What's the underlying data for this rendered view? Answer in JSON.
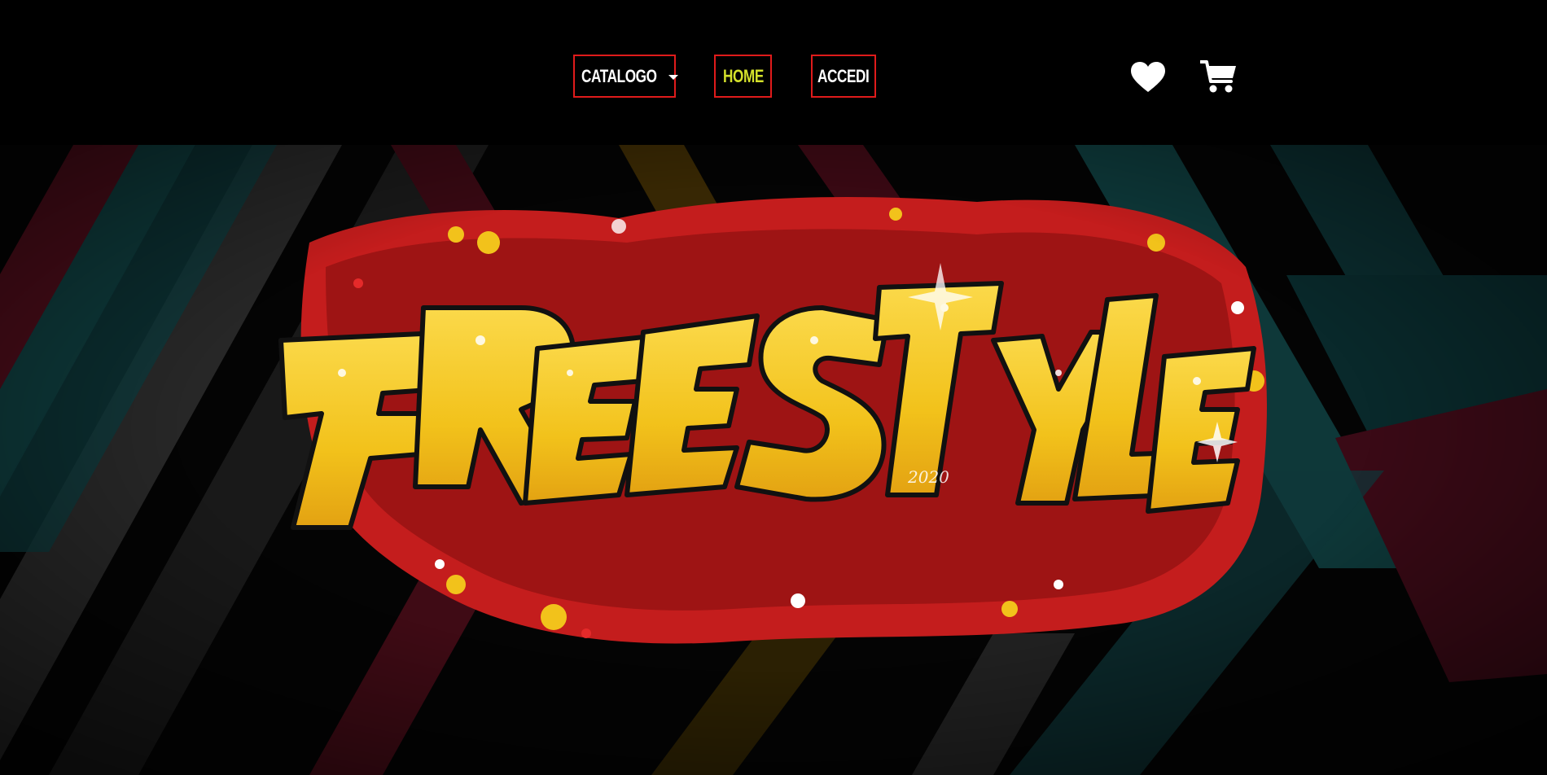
{
  "nav": {
    "items": [
      {
        "label": "CATALOGO",
        "has_dropdown": true,
        "color": "#ffffff"
      },
      {
        "label": "HOME",
        "active": true,
        "color": "#d4e12b"
      },
      {
        "label": "ACCEDI",
        "color": "#ffffff"
      }
    ],
    "border_color": "#e01b1b"
  },
  "icons": {
    "wishlist": "heart-icon",
    "cart": "cart-icon"
  },
  "hero": {
    "logo_text": "FREESTYLE",
    "logo_tag": "2020",
    "colors": {
      "yellow": "#f2c21b",
      "red": "#c41d1d",
      "teal": "#0f3b3d",
      "maroon": "#4a0d1a",
      "gray": "#3a3a3a"
    }
  }
}
